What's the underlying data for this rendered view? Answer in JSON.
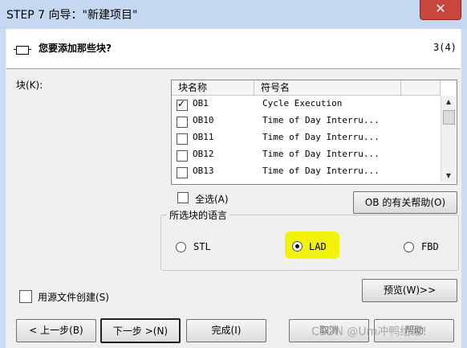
{
  "window": {
    "title": "STEP 7 向导：\"新建项目\"",
    "close_glyph": "✕"
  },
  "header": {
    "question": "您要添加那些块?",
    "step": "3(4)",
    "icon": "module-icon"
  },
  "blocks_label": "块(K):",
  "block_list": {
    "columns": [
      "块名称",
      "符号名"
    ],
    "rows": [
      {
        "name": "OB1",
        "symbol": "Cycle Execution",
        "checked": true
      },
      {
        "name": "OB10",
        "symbol": "Time of Day Interru...",
        "checked": false
      },
      {
        "name": "OB11",
        "symbol": "Time of Day Interru...",
        "checked": false
      },
      {
        "name": "OB12",
        "symbol": "Time of Day Interru...",
        "checked": false
      },
      {
        "name": "OB13",
        "symbol": "Time of Day Interru...",
        "checked": false
      }
    ]
  },
  "select_all_label": "全选(A)",
  "ob_help_button": "OB 的有关帮助(O)",
  "language_group": {
    "title": "所选块的语言",
    "options": [
      {
        "label": "STL",
        "selected": false
      },
      {
        "label": "LAD",
        "selected": true
      },
      {
        "label": "FBD",
        "selected": false
      }
    ],
    "highlight_color": "#f2f20a"
  },
  "source_file_label": "用源文件创建(S)",
  "preview_button": "预览(W)>>",
  "footer": {
    "back_button": "< 上一步(B)",
    "next_button": "下一步 >(N)",
    "finish_button": "完成(I)",
    "cancel_button": "取消",
    "help_button": "帮助"
  },
  "watermark": "CSDN @Um冲鸭给给!"
}
